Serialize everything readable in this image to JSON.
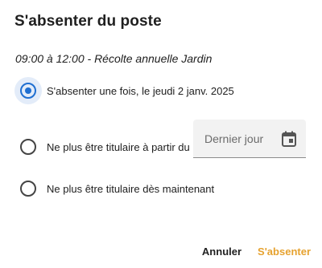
{
  "dialog": {
    "title": "S'absenter du poste",
    "shift_text": "09:00 à 12:00 - Récolte annuelle Jardin"
  },
  "options": [
    {
      "label": "S'absenter une fois, le jeudi 2 janv. 2025",
      "selected": true
    },
    {
      "label": "Ne plus être titulaire à partir du",
      "selected": false
    },
    {
      "label": "Ne plus être titulaire dès maintenant",
      "selected": false
    }
  ],
  "date_field": {
    "placeholder": "Dernier jour",
    "icon": "calendar-icon"
  },
  "actions": {
    "cancel_label": "Annuler",
    "confirm_label": "S'absenter"
  },
  "colors": {
    "accent": "#1f6fd1",
    "confirm": "#e6a22f",
    "focus_halo": "#e3ecf9"
  }
}
